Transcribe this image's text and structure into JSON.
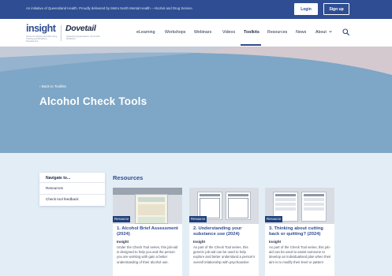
{
  "topbar": {
    "notice": "An initiative of Queensland Health. Proudly delivered by Metro North Mental Health – Alcohol and Drug Service.",
    "login_label": "Login",
    "signup_label": "Sign up"
  },
  "logos": {
    "insight": "insight",
    "insight_tagline": "Centre for Alcohol and Other Drug Training and Workforce Development",
    "dovetail": "Dovetail",
    "dovetail_tagline": "Supporting Queensland's Youth AOD Workforce"
  },
  "nav": {
    "items": [
      {
        "label": "eLearning"
      },
      {
        "label": "Workshops"
      },
      {
        "label": "Webinars"
      },
      {
        "label": "Videos"
      },
      {
        "label": "Toolkits"
      },
      {
        "label": "Resources"
      },
      {
        "label": "News"
      },
      {
        "label": "About"
      }
    ],
    "active": "Toolkits",
    "about_icon": "chevron-down-icon",
    "search_icon": "search-icon"
  },
  "hero": {
    "back_label": "‹  Back to Toolkits",
    "title": "Alcohol Check Tools"
  },
  "sidebar": {
    "heading": "Navigate to...",
    "links": [
      {
        "label": "Resources"
      },
      {
        "label": "Check tool feedback"
      }
    ]
  },
  "resources": {
    "heading": "Resources",
    "cards": [
      {
        "badge": "Resource",
        "title": "1. Alcohol Brief Assessment (2024)",
        "source": "Insight",
        "description": "Under the Check Tool series, this job-aid is designed to help you and the person you are working with gain a better understanding of their alcohol use."
      },
      {
        "badge": "Resource",
        "title": "2. Understanding your substance use (2024)",
        "source": "Insight",
        "description": "As part of the Check Tool series, this generic job-aid can be used to help explore and better understand a person's overall relationship with psychoactive"
      },
      {
        "badge": "Resource",
        "title": "3. Thinking about cutting back or quitting? (2024)",
        "source": "Insight",
        "description": "As part of the Check Tool series, this job-aid can be used to assist someone to develop an individualised plan when their aim is to modify their level or pattern"
      }
    ]
  },
  "colors": {
    "brand_blue": "#2f4d92",
    "hero_blue": "#7ea6c6",
    "page_bg": "#e3edf5"
  }
}
